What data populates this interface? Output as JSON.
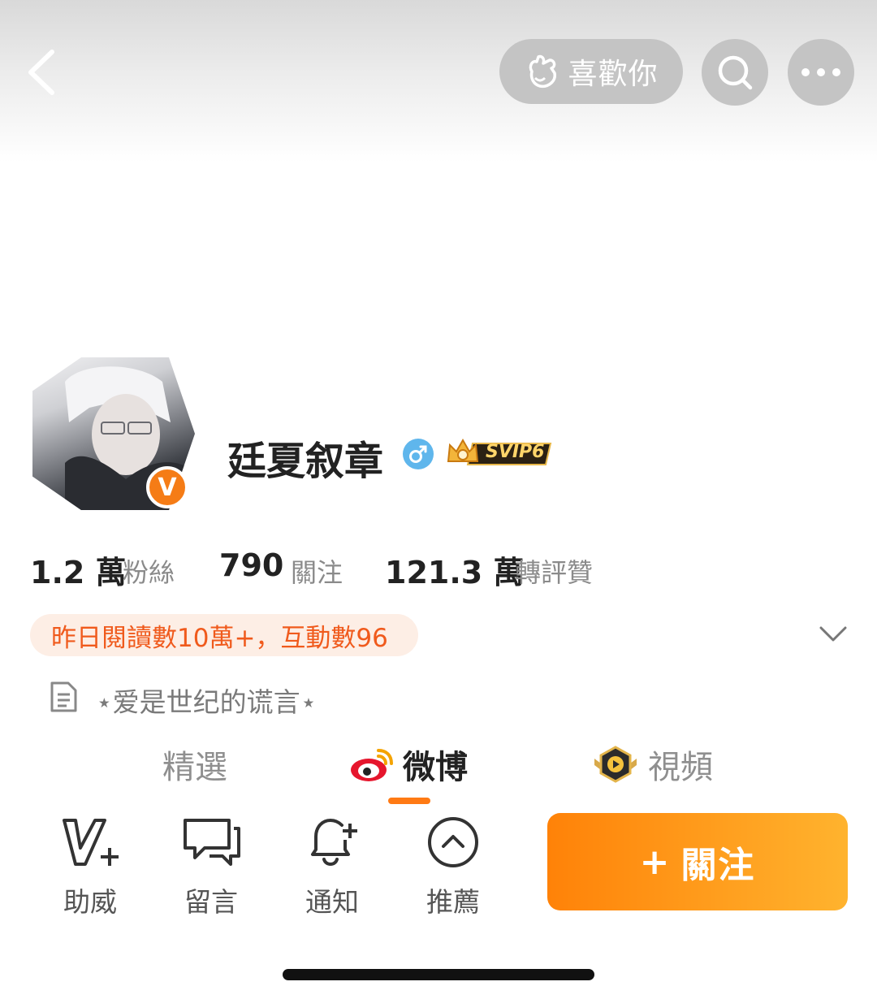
{
  "header": {
    "like_label": "喜歡你",
    "icons": {
      "back": "chevron-left-icon",
      "like": "hand-heart-icon",
      "search": "search-icon",
      "more": "more-dots-icon"
    }
  },
  "profile": {
    "name": "廷夏叙章",
    "vip_label": "SVIP6",
    "verified_badge": "V",
    "gender_icon": "male-icon",
    "colors": {
      "verified": "#f57c16",
      "gender": "#5fb6ec",
      "accent": "#ff7a14"
    }
  },
  "stats": [
    {
      "value": "1.2 萬",
      "label": "粉絲"
    },
    {
      "value": "790",
      "label": "關注"
    },
    {
      "value": "121.3 萬",
      "label": "轉評贊"
    }
  ],
  "reading_summary": "昨日閱讀數10萬+，互動數96",
  "bio": "⋆爱是世纪的谎言⋆",
  "tabs": [
    {
      "label": "精選",
      "active": false
    },
    {
      "label": "微博",
      "active": true,
      "icon": "weibo-logo-icon"
    },
    {
      "label": "視頻",
      "active": false,
      "icon": "video-badge-icon"
    }
  ],
  "actions": [
    {
      "label": "助威",
      "icon": "v-plus-icon"
    },
    {
      "label": "留言",
      "icon": "chat-bubbles-icon"
    },
    {
      "label": "通知",
      "icon": "bell-plus-icon"
    },
    {
      "label": "推薦",
      "icon": "chevron-up-circle-icon"
    }
  ],
  "follow_button": {
    "plus": "+",
    "label": "關注"
  }
}
